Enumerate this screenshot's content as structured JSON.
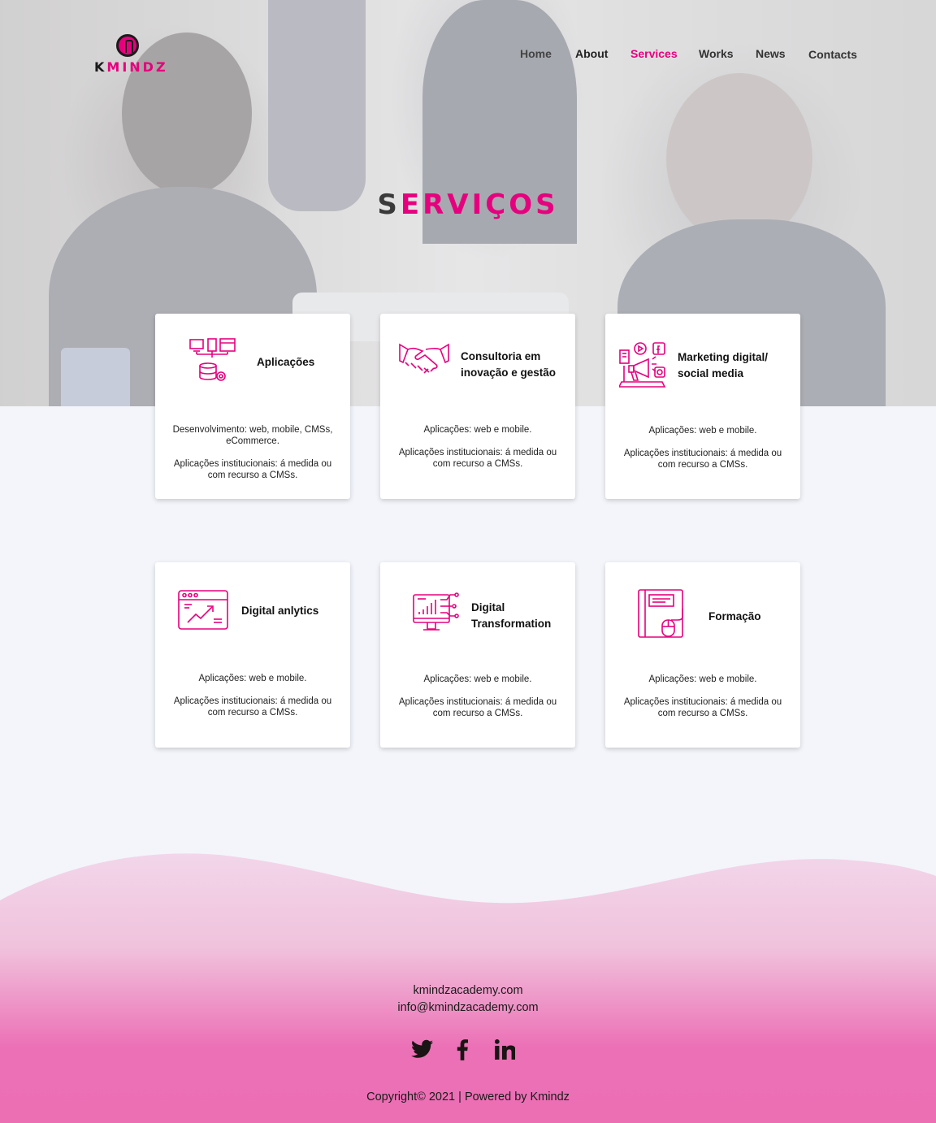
{
  "brand": {
    "logo_text_first": "K",
    "logo_text_rest": "MINDZ"
  },
  "nav": {
    "home": "Home",
    "about": "About",
    "services": "Services",
    "works": "Works",
    "news": "News",
    "contacts": "Contacts"
  },
  "page": {
    "title_first": "S",
    "title_rest": "ERVIÇOS"
  },
  "services": [
    {
      "title_line1": "Aplicações",
      "title_line2": "",
      "icon": "applications-icon",
      "desc_1": "Desenvolvimento:  web, mobile, CMSs, eCommerce.",
      "desc_2": "Aplicações institucionais: á medida ou com recurso a CMSs."
    },
    {
      "title_line1": "Consultoria em",
      "title_line2": "inovação e gestão",
      "icon": "handshake-icon",
      "desc_1": "Aplicações:  web e mobile.",
      "desc_2": "Aplicações institucionais: á medida ou com recurso a CMSs."
    },
    {
      "title_line1": "Marketing digital/",
      "title_line2": "social  media",
      "icon": "megaphone-icon",
      "desc_1": "Aplicações:  web e mobile.",
      "desc_2": "Aplicações institucionais: á medida ou com recurso a CMSs."
    },
    {
      "title_line1": "Digital anlytics",
      "title_line2": "",
      "icon": "analytics-icon",
      "desc_1": "Aplicações:  web e mobile.",
      "desc_2": "Aplicações institucionais: á medida ou com recurso a CMSs."
    },
    {
      "title_line1": "Digital",
      "title_line2": "Transformation",
      "icon": "digital-transformation-icon",
      "desc_1": "Aplicações:  web e mobile.",
      "desc_2": "Aplicações institucionais: á medida ou com recurso a CMSs."
    },
    {
      "title_line1": "Formação",
      "title_line2": "",
      "icon": "training-book-icon",
      "desc_1": "Aplicações:  web e mobile.",
      "desc_2": "Aplicações institucionais: á medida ou com recurso a CMSs."
    }
  ],
  "footer": {
    "website": "kmindzacademy.com",
    "email": "info@kmindzacademy.com",
    "social": [
      "twitter-icon",
      "facebook-icon",
      "linkedin-icon"
    ],
    "copyright": "Copyright© 2021 | Powered by Kmindz"
  },
  "colors": {
    "accent": "#e6007e",
    "background": "#f3f5fa",
    "footer_top": "#f2d6ea",
    "footer_bottom": "#ec6fb4"
  }
}
